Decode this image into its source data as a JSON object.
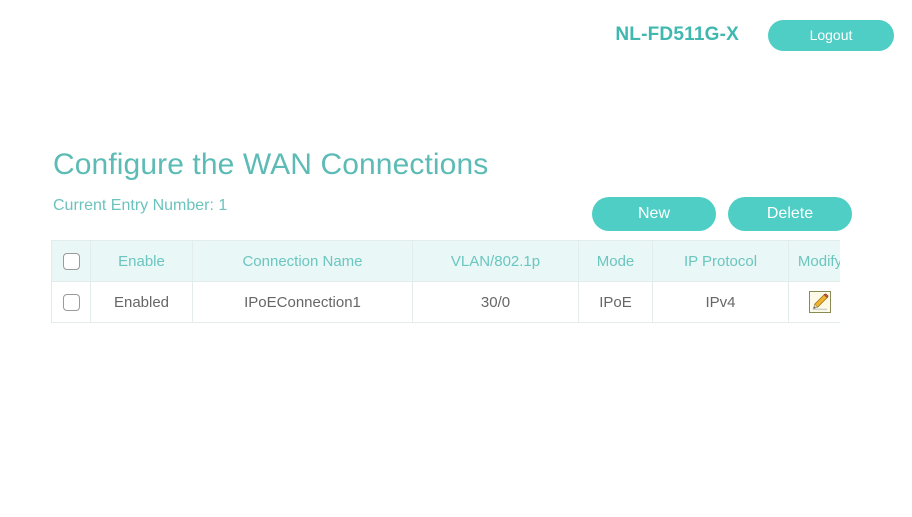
{
  "header": {
    "device_name": "NL-FD511G-X",
    "logout_label": "Logout"
  },
  "page": {
    "title": "Configure the WAN Connections",
    "entry_count_label": "Current Entry Number: 1"
  },
  "toolbar": {
    "new_label": "New",
    "delete_label": "Delete"
  },
  "table": {
    "columns": [
      {
        "key": "select",
        "label": ""
      },
      {
        "key": "enable",
        "label": "Enable"
      },
      {
        "key": "name",
        "label": "Connection Name"
      },
      {
        "key": "vlan",
        "label": "VLAN/802.1p"
      },
      {
        "key": "mode",
        "label": "Mode"
      },
      {
        "key": "proto",
        "label": "IP Protocol"
      },
      {
        "key": "modify",
        "label": "Modify"
      }
    ],
    "rows": [
      {
        "selected": false,
        "enable": "Enabled",
        "name": "IPoEConnection1",
        "vlan": "30/0",
        "mode": "IPoE",
        "proto": "IPv4",
        "modify_icon": "pencil-edit-icon"
      }
    ]
  },
  "colors": {
    "accent_teal": "#4ecec4",
    "title_teal": "#5cbcb5",
    "device_teal": "#3fb8b0",
    "header_cell_bg": "#e9f7f6",
    "header_cell_text": "#6bc6c0",
    "cell_text": "#666666",
    "page_bg": "#ffffff"
  }
}
